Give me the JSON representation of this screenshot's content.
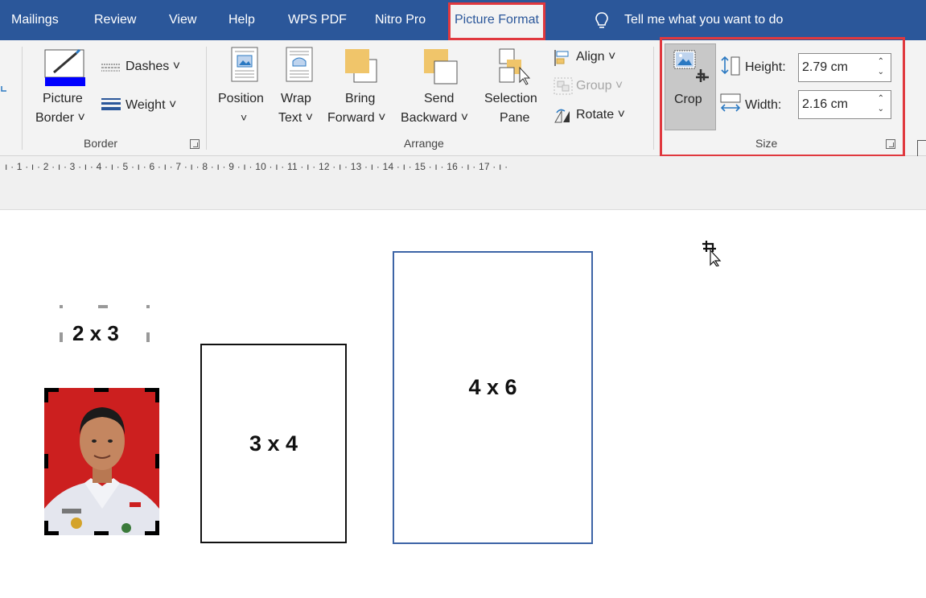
{
  "tabs": [
    {
      "label": "Mailings"
    },
    {
      "label": "Review"
    },
    {
      "label": "View"
    },
    {
      "label": "Help"
    },
    {
      "label": "WPS PDF"
    },
    {
      "label": "Nitro Pro"
    },
    {
      "label": "Picture Format",
      "active": true
    }
  ],
  "tellme": {
    "label": "Tell me what you want to do"
  },
  "ribbon": {
    "border_group": {
      "picture_border": [
        "Picture",
        "Border ˅"
      ],
      "dashes": "Dashes ˅",
      "weight": "Weight ˅",
      "label": "Border",
      "border_color": "#0000ff"
    },
    "arrange_group": {
      "position": [
        "Position",
        "˅"
      ],
      "wrap_text": [
        "Wrap",
        "Text ˅"
      ],
      "bring_forward": [
        "Bring",
        "Forward ˅"
      ],
      "send_backward": [
        "Send",
        "Backward ˅"
      ],
      "selection_pane": [
        "Selection",
        "Pane"
      ],
      "align": "Align ˅",
      "group": "Group ˅",
      "rotate": "Rotate ˅",
      "label": "Arrange"
    },
    "size_group": {
      "crop": "Crop",
      "height_label": "Height:",
      "height_value": "2.79 cm",
      "width_label": "Width:",
      "width_value": "2.16 cm",
      "label": "Size"
    }
  },
  "ruler": {
    "marks": "ı · 1 · ı · 2 · ı · 3 · ı · 4 · ı · 5 · ı · 6 · ı · 7 · ı · 8 · ı · 9 · ı · 10 · ı · 11 · ı · 12 · ı · 13 · ı · 14 · ı · 15 · ı · 16 · ı · 17 · ı ·"
  },
  "document": {
    "label_2x3": "2 x 3",
    "label_3x4": "3 x 4",
    "label_4x6": "4 x 6"
  },
  "colors": {
    "tab_bar": "#2b579a",
    "highlight": "#e0383e",
    "photo_bg": "#cc1f1f"
  }
}
